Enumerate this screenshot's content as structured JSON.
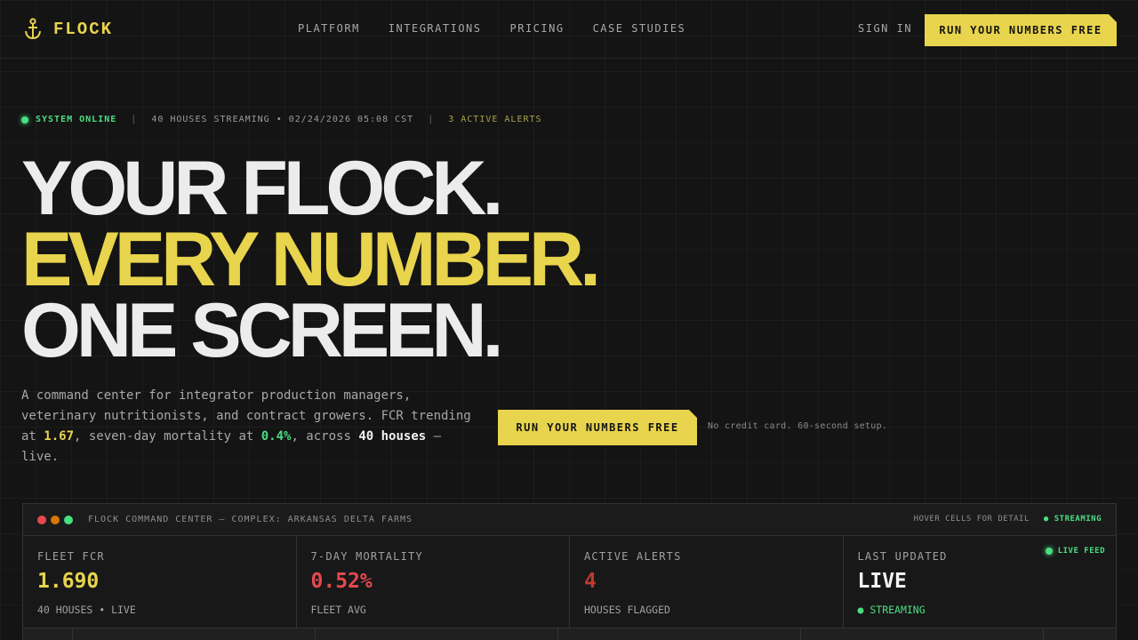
{
  "brand": {
    "name": "FLOCK"
  },
  "nav": {
    "links": [
      "PLATFORM",
      "INTEGRATIONS",
      "PRICING",
      "CASE STUDIES"
    ],
    "sign_in": "SIGN IN",
    "cta": "RUN YOUR NUMBERS FREE"
  },
  "status": {
    "online": "SYSTEM ONLINE",
    "sep": "|",
    "streaming": "40 HOUSES STREAMING • 02/24/2026 05:08 CST",
    "alerts": "3 ACTIVE ALERTS"
  },
  "hero": {
    "line1": "YOUR FLOCK.",
    "line2": "EVERY NUMBER.",
    "line3": "ONE SCREEN."
  },
  "description": {
    "part1": "A command center for integrator production managers, veterinary nutritionists, and contract growers. FCR trending at ",
    "fcr": "1.67",
    "part2": ", seven-day mortality at ",
    "mortality": "0.4%",
    "part3": ", across ",
    "houses": "40 houses",
    "part4": " — live."
  },
  "cta": {
    "label": "RUN YOUR NUMBERS FREE",
    "note": "No credit card. 60-second setup."
  },
  "panel": {
    "title": "FLOCK COMMAND CENTER — COMPLEX: ARKANSAS DELTA FARMS",
    "hover_hint": "HOVER CELLS FOR DETAIL",
    "streaming": "● STREAMING",
    "live_feed": "LIVE FEED",
    "stats": [
      {
        "label": "FLEET FCR",
        "value": "1.690",
        "sub": "40 HOUSES • LIVE",
        "color": "#e8d44d"
      },
      {
        "label": "7-DAY MORTALITY",
        "value": "0.52%",
        "sub": "FLEET AVG",
        "color": "#e5484d"
      },
      {
        "label": "ACTIVE ALERTS",
        "value": "4",
        "sub": "HOUSES FLAGGED",
        "color": "#c0392b"
      },
      {
        "label": "LAST UPDATED",
        "value": "LIVE",
        "sub": "● STREAMING",
        "color": "#f2f2f2"
      }
    ]
  },
  "colors": {
    "accent": "#e8d44d",
    "success": "#4ade80",
    "danger": "#e5484d",
    "background": "#141414"
  }
}
